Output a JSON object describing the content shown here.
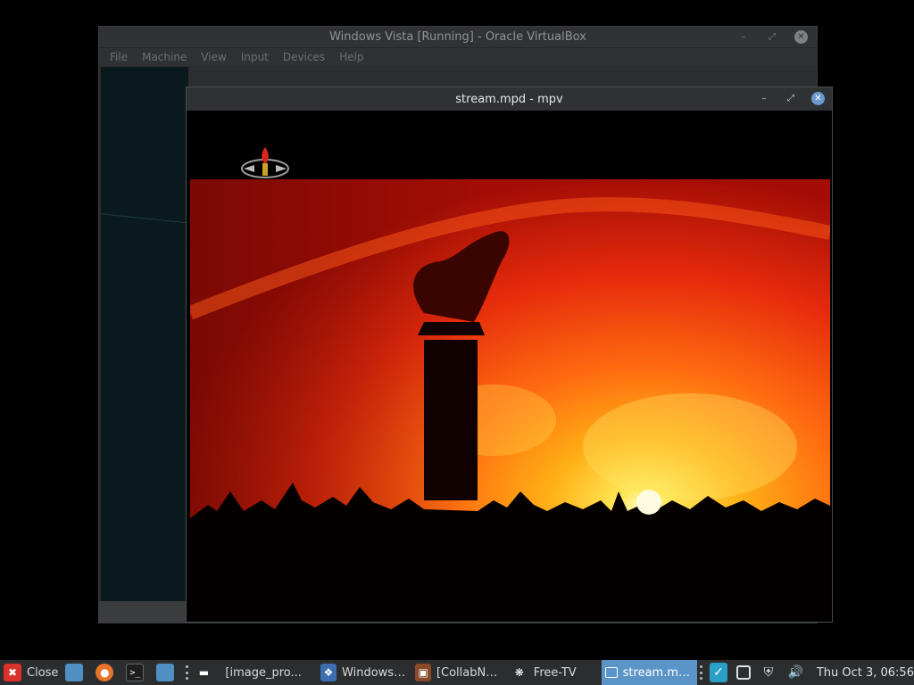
{
  "virtualbox": {
    "title": "Windows Vista [Running] - Oracle VirtualBox",
    "menu": [
      "File",
      "Machine",
      "View",
      "Input",
      "Devices",
      "Help"
    ]
  },
  "mpv": {
    "title": "stream.mpd - mpv"
  },
  "taskbar": {
    "close_label": "Close",
    "tasks": [
      {
        "label": "[image_pro...",
        "icon": "image-icon",
        "active": false
      },
      {
        "label": "Windows V...",
        "icon": "virtualbox-icon",
        "active": false
      },
      {
        "label": "[CollabNet ...",
        "icon": "document-icon",
        "active": false
      },
      {
        "label": "Free-TV",
        "icon": "tv-icon",
        "active": false
      },
      {
        "label": "stream.mp...",
        "icon": "mpv-icon",
        "active": true
      }
    ],
    "clock": "Thu Oct  3, 06:56"
  },
  "colors": {
    "accent": "#5b94c7",
    "close_red": "#d9322b",
    "firefox_orange": "#e8742a",
    "files_blue": "#4f8fc4"
  }
}
